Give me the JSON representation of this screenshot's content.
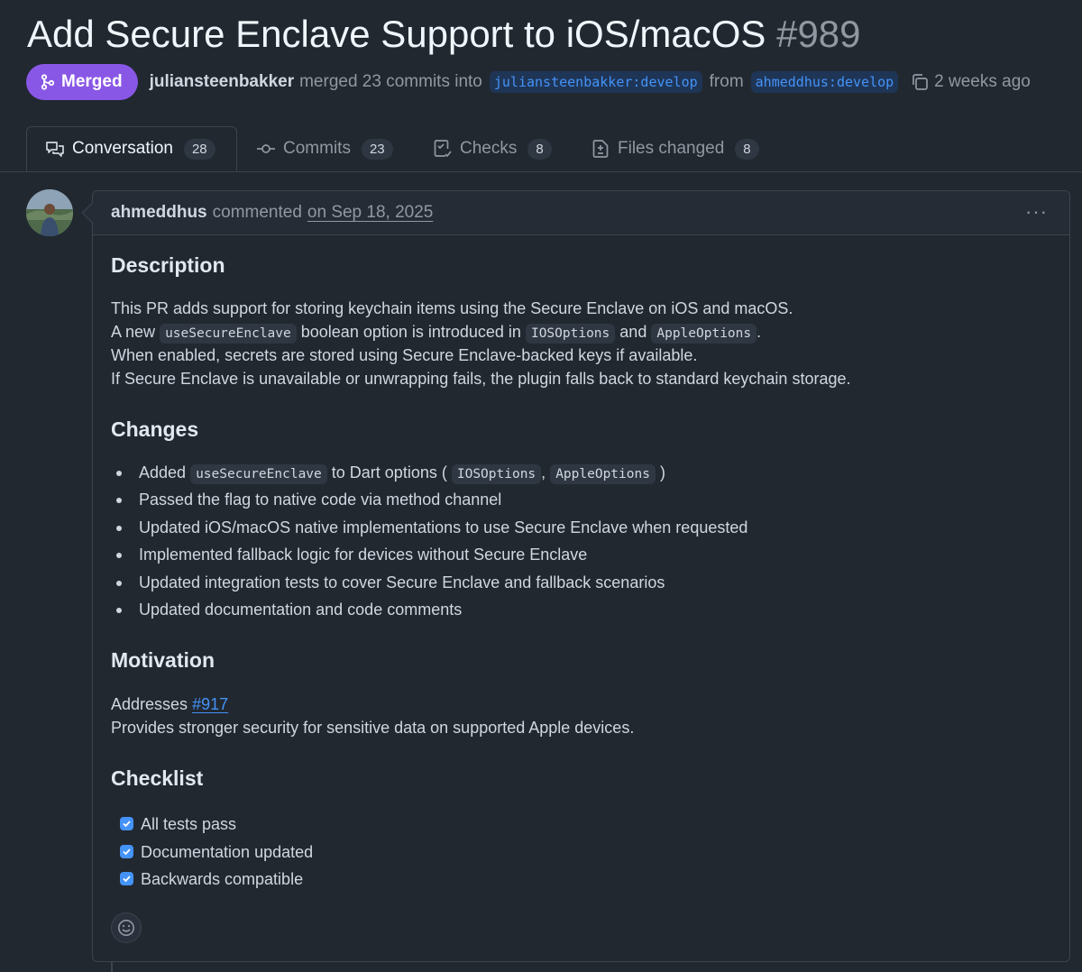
{
  "pr": {
    "title": "Add Secure Enclave Support to iOS/macOS",
    "number": "#989",
    "status": "Merged",
    "merger": "juliansteenbakker",
    "merged_text": "merged 23 commits into",
    "base_branch": "juliansteenbakker:develop",
    "from_text": "from",
    "head_branch": "ahmeddhus:develop",
    "time_ago": "2 weeks ago"
  },
  "tabs": [
    {
      "label": "Conversation",
      "count": "28",
      "icon": "comment-discussion-icon",
      "active": true
    },
    {
      "label": "Commits",
      "count": "23",
      "icon": "git-commit-icon"
    },
    {
      "label": "Checks",
      "count": "8",
      "icon": "checklist-icon"
    },
    {
      "label": "Files changed",
      "count": "8",
      "icon": "file-diff-icon"
    }
  ],
  "comment": {
    "author": "ahmeddhus",
    "action": "commented",
    "date": "on Sep 18, 2025",
    "sections": {
      "description": {
        "heading": "Description",
        "line1": "This PR adds support for storing keychain items using the Secure Enclave on iOS and macOS.",
        "line2_a": "A new",
        "line2_code1": "useSecureEnclave",
        "line2_b": "boolean option is introduced in",
        "line2_code2": "IOSOptions",
        "line2_c": "and",
        "line2_code3": "AppleOptions",
        "line2_d": ".",
        "line3": "When enabled, secrets are stored using Secure Enclave-backed keys if available.",
        "line4": "If Secure Enclave is unavailable or unwrapping fails, the plugin falls back to standard keychain storage."
      },
      "changes": {
        "heading": "Changes",
        "item1_a": "Added",
        "item1_code1": "useSecureEnclave",
        "item1_b": "to Dart options (",
        "item1_code2": "IOSOptions",
        "item1_c": ",",
        "item1_code3": "AppleOptions",
        "item1_d": ")",
        "item2": "Passed the flag to native code via method channel",
        "item3": "Updated iOS/macOS native implementations to use Secure Enclave when requested",
        "item4": "Implemented fallback logic for devices without Secure Enclave",
        "item5": "Updated integration tests to cover Secure Enclave and fallback scenarios",
        "item6": "Updated documentation and code comments"
      },
      "motivation": {
        "heading": "Motivation",
        "addresses": "Addresses",
        "issue_link": "#917",
        "line2": "Provides stronger security for sensitive data on supported Apple devices."
      },
      "checklist": {
        "heading": "Checklist",
        "items": [
          "All tests pass",
          "Documentation updated",
          "Backwards compatible"
        ]
      }
    }
  },
  "colors": {
    "background": "#212830",
    "merged_badge": "#8957e5",
    "link": "#4493f8",
    "border": "#3d444d"
  }
}
